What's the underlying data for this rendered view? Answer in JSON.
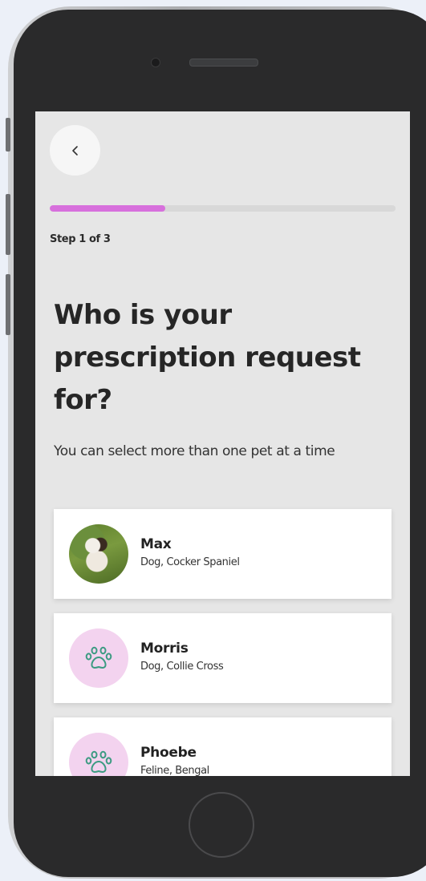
{
  "header": {
    "back_icon": "chevron-left-icon"
  },
  "progress": {
    "current_step": 1,
    "total_steps": 3,
    "fraction": 0.333,
    "label": "Step 1 of 3",
    "fill_color": "#d770dc"
  },
  "main": {
    "title": "Who is your prescription request for?",
    "subtitle": "You can select more than one pet at a time"
  },
  "pets": [
    {
      "name": "Max",
      "description": "Dog, Cocker Spaniel",
      "avatar": "photo"
    },
    {
      "name": "Morris",
      "description": "Dog, Collie Cross",
      "avatar": "paw-icon"
    },
    {
      "name": "Phoebe",
      "description": "Feline, Bengal",
      "avatar": "paw-icon"
    }
  ],
  "colors": {
    "accent": "#d770dc",
    "paw_icon": "#3c9b82",
    "paw_bg": "#f3d3ef"
  }
}
